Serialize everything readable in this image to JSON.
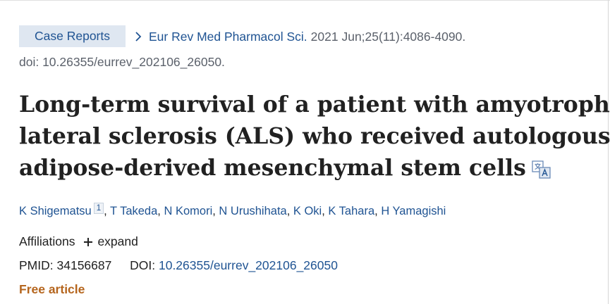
{
  "header": {
    "publication_type": "Case Reports",
    "journal": "Eur Rev Med Pharmacol Sci.",
    "citation": "2021 Jun;25(11):4086-4090.",
    "doi_line": "doi: 10.26355/eurrev_202106_26050."
  },
  "article": {
    "title_line1": "Long-term survival of a patient with amyotrophic",
    "title_line2": "lateral sclerosis (ALS) who received autologous",
    "title_line3": "adipose-derived mesenchymal stem cells",
    "title_icon": "translate-icon"
  },
  "authors": [
    {
      "name": "K Shigematsu",
      "affiliation_ref": "1"
    },
    {
      "name": "T Takeda"
    },
    {
      "name": "N Komori"
    },
    {
      "name": "N Urushihata"
    },
    {
      "name": "K Oki"
    },
    {
      "name": "K Tahara"
    },
    {
      "name": "H Yamagishi"
    }
  ],
  "affiliations": {
    "label": "Affiliations",
    "expand_label": "expand",
    "expand_icon": "plus-icon"
  },
  "identifiers": {
    "pmid_label": "PMID:",
    "pmid": "34156687",
    "doi_label": "DOI:",
    "doi": "10.26355/eurrev_202106_26050"
  },
  "access": {
    "free_label": "Free article"
  },
  "colors": {
    "link": "#205493",
    "badge_bg": "#dfe7f1",
    "free": "#b5651d",
    "muted": "#5b616b",
    "text": "#212121"
  }
}
